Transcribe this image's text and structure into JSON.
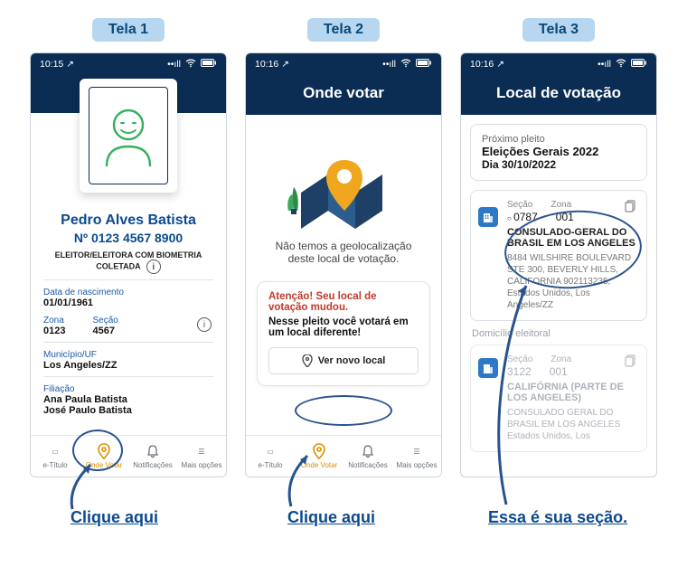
{
  "labels": {
    "tela1": "Tela 1",
    "tela2": "Tela 2",
    "tela3": "Tela 3"
  },
  "annotations": {
    "click1": "Clique aqui",
    "click2": "Clique aqui",
    "section": "Essa é sua seção."
  },
  "statusbar": {
    "time1": "10:15",
    "time2": "10:16",
    "time3": "10:16",
    "loc_arrow": "↗",
    "signal": "▯ıll",
    "wifi": "᯾",
    "batt": "▭"
  },
  "screen1": {
    "name": "Pedro Alves Batista",
    "number_label": "Nº",
    "number": "0123 4567 8900",
    "status": "ELEITOR/ELEITORA COM BIOMETRIA COLETADA",
    "dob_label": "Data de nascimento",
    "dob": "01/01/1961",
    "zona_label": "Zona",
    "zona": "0123",
    "secao_label": "Seção",
    "secao": "4567",
    "municipio_label": "Município/UF",
    "municipio": "Los Angeles/ZZ",
    "filiacao_label": "Filiação",
    "filiacao1": "Ana Paula Batista",
    "filiacao2": "José Paulo Batista",
    "info_glyph": "i"
  },
  "screen2": {
    "title": "Onde votar",
    "msg": "Não temos a geolocalização deste local de votação.",
    "warn": "Atenção! Seu local de votação mudou.",
    "note": "Nesse pleito você votará em um local diferente!",
    "btn": "Ver novo local"
  },
  "screen3": {
    "title": "Local de votação",
    "next_label": "Próximo pleito",
    "next_name": "Eleições Gerais 2022",
    "next_date": "Dia 30/10/2022",
    "secao_label": "Seção",
    "zona_label": "Zona",
    "p1_secao": "0787",
    "p1_zona": "001",
    "p1_name": "CONSULADO-GERAL DO BRASIL EM LOS ANGELES",
    "p1_addr": "8484 WILSHIRE BOULEVARD STE 300, BEVERLY HILLS, CALIFORNIA 902113235, Estados Unidos, Los Angeles/ZZ",
    "domicilio": "Domicílio eleitoral",
    "p2_secao": "3122",
    "p2_zona": "001",
    "p2_name": "CALIFÓRNIA (PARTE DE LOS ANGELES)",
    "p2_addr": "CONSULADO GERAL DO BRASIL EM LOS ANGELES Estados Unidos, Los"
  },
  "nav": {
    "item1": "e-Título",
    "item2": "Onde Votar",
    "item3": "Notificações",
    "item4": "Mais opções"
  }
}
